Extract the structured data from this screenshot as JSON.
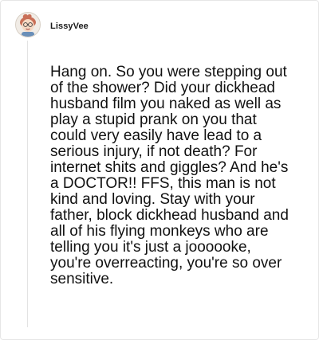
{
  "comment": {
    "author": "LissyVee",
    "avatar_icon": "cartoon-face-avatar-icon",
    "body": "Hang on. So you were stepping out of the shower? Did your dickhead husband film you naked as well as play a stupid prank on you that could very easily have lead to a serious injury, if not death? For internet shits and giggles? And he's a DOCTOR!! FFS, this man is not kind and loving. Stay with your father, block dickhead husband and all of his flying monkeys who are telling you it's just a joooooke, you're overreacting, you're so over sensitive."
  }
}
